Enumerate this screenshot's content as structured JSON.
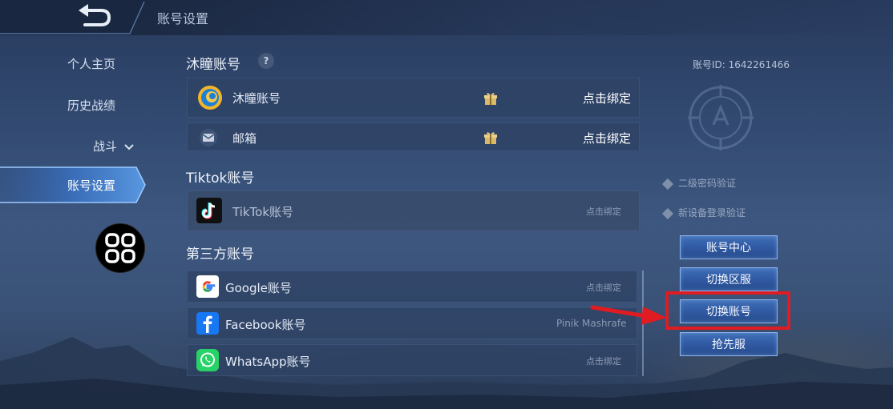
{
  "header": {
    "title": "账号设置"
  },
  "nav": {
    "items": [
      {
        "label": "个人主页"
      },
      {
        "label": "历史战绩"
      },
      {
        "label": "战斗"
      },
      {
        "label": "账号设置"
      }
    ]
  },
  "sections": {
    "mutong": {
      "title": "沐瞳账号",
      "help": "?",
      "rows": [
        {
          "label": "沐瞳账号",
          "action": "点击绑定"
        },
        {
          "label": "邮箱",
          "action": "点击绑定"
        }
      ]
    },
    "tiktok": {
      "title": "Tiktok账号",
      "rows": [
        {
          "label": "TikTok账号",
          "action": "点击绑定"
        }
      ]
    },
    "third_party": {
      "title": "第三方账号",
      "rows": [
        {
          "label": "Google账号",
          "action": "点击绑定"
        },
        {
          "label": "Facebook账号",
          "action": "Pinik Mashrafe"
        },
        {
          "label": "WhatsApp账号",
          "action": "点击绑定"
        }
      ]
    }
  },
  "right_panel": {
    "account_id": "账号ID:   1642261466",
    "checks": [
      {
        "label": "二级密码验证"
      },
      {
        "label": "新设备登录验证"
      }
    ],
    "buttons": [
      {
        "label": "账号中心"
      },
      {
        "label": "切换区服"
      },
      {
        "label": "切换账号"
      },
      {
        "label": "抢先服"
      }
    ]
  },
  "icons": {
    "back": "back-arrow-icon",
    "help": "question-icon",
    "gift": "gift-icon",
    "dropdown": "chevron-down-icon",
    "grid": "grid-menu-icon"
  },
  "colors": {
    "highlight": "#e11b22",
    "button_blue": "#2f58a0"
  }
}
